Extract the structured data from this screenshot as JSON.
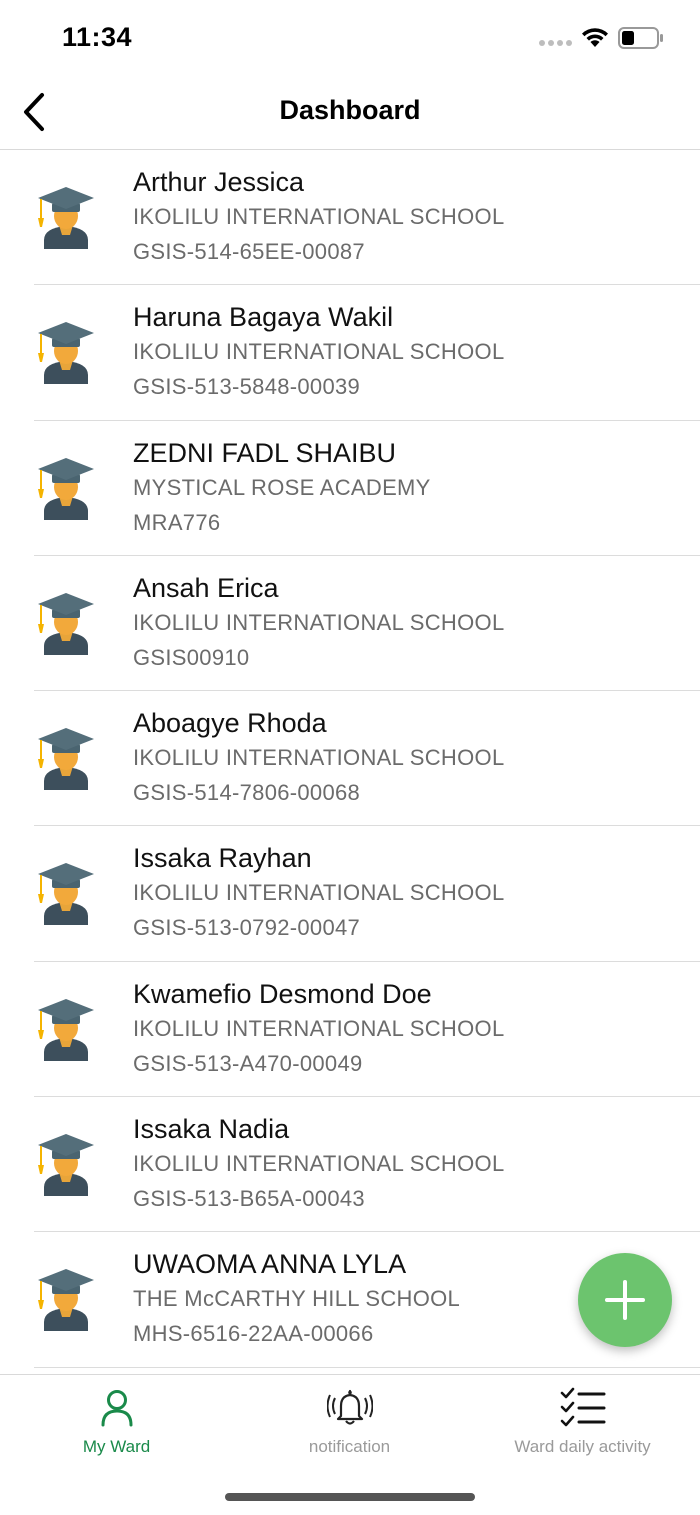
{
  "status_bar": {
    "time": "11:34"
  },
  "nav": {
    "title": "Dashboard"
  },
  "wards": [
    {
      "name": "Arthur Jessica",
      "school": "IKOLILU INTERNATIONAL SCHOOL",
      "id": "GSIS-514-65EE-00087"
    },
    {
      "name": "Haruna Bagaya Wakil",
      "school": "IKOLILU INTERNATIONAL SCHOOL",
      "id": "GSIS-513-5848-00039"
    },
    {
      "name": "ZEDNI FADL SHAIBU",
      "school": "MYSTICAL ROSE ACADEMY",
      "id": "MRA776"
    },
    {
      "name": "Ansah Erica",
      "school": "IKOLILU INTERNATIONAL SCHOOL",
      "id": "GSIS00910"
    },
    {
      "name": "Aboagye Rhoda",
      "school": "IKOLILU INTERNATIONAL SCHOOL",
      "id": "GSIS-514-7806-00068"
    },
    {
      "name": "Issaka Rayhan",
      "school": "IKOLILU INTERNATIONAL SCHOOL",
      "id": "GSIS-513-0792-00047"
    },
    {
      "name": "Kwamefio Desmond Doe",
      "school": "IKOLILU INTERNATIONAL SCHOOL",
      "id": "GSIS-513-A470-00049"
    },
    {
      "name": "Issaka Nadia",
      "school": "IKOLILU INTERNATIONAL SCHOOL",
      "id": "GSIS-513-B65A-00043"
    },
    {
      "name": "UWAOMA ANNA LYLA",
      "school": "THE McCARTHY HILL SCHOOL",
      "id": "MHS-6516-22AA-00066"
    }
  ],
  "tabs": [
    {
      "label": "My Ward",
      "icon": "person-icon",
      "active": true
    },
    {
      "label": "notification",
      "icon": "bell-icon",
      "active": false
    },
    {
      "label": "Ward daily activity",
      "icon": "checklist-icon",
      "active": false
    }
  ],
  "colors": {
    "accent_green": "#1a8a4a",
    "fab_green": "#6cc46e",
    "secondary_text": "#6b6b6b"
  }
}
